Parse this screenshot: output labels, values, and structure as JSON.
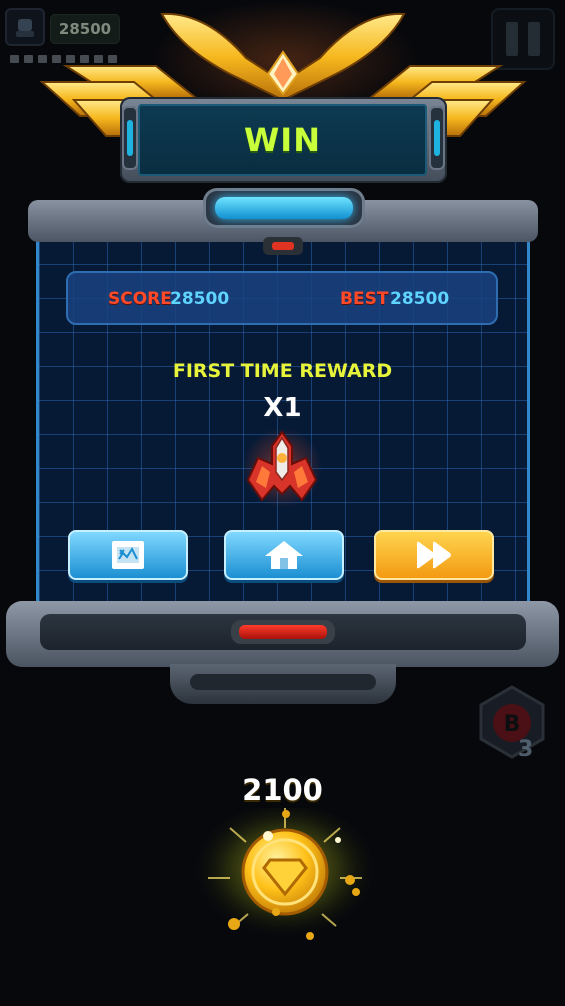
{
  "hud": {
    "score": "28500",
    "icons": {
      "avatar": "pilot-avatar-icon",
      "pause": "pause-icon"
    }
  },
  "banner": {
    "title": "WIN"
  },
  "stats": {
    "score_label": "SCORE",
    "score_value": "28500",
    "best_label": "BEST",
    "best_value": "28500"
  },
  "reward": {
    "title": "FIRST TIME REWARD",
    "multiplier": "X1",
    "item_icon": "spaceship-reward-icon"
  },
  "buttons": [
    {
      "name": "map-button",
      "icon": "map-icon"
    },
    {
      "name": "home-button",
      "icon": "home-icon"
    },
    {
      "name": "next-button",
      "icon": "fast-forward-icon"
    }
  ],
  "bomb": {
    "label": "B",
    "count": "3"
  },
  "coins": {
    "amount": "2100",
    "icon": "gold-coin-icon"
  },
  "colors": {
    "win_text": "#c8ff3a",
    "score_label": "#ff4a2a",
    "score_value": "#5fd4ff",
    "reward_title": "#e8f43a",
    "button_blue": "#1c8fd2",
    "button_orange": "#f39a12",
    "panel_grid": "#061a36"
  }
}
